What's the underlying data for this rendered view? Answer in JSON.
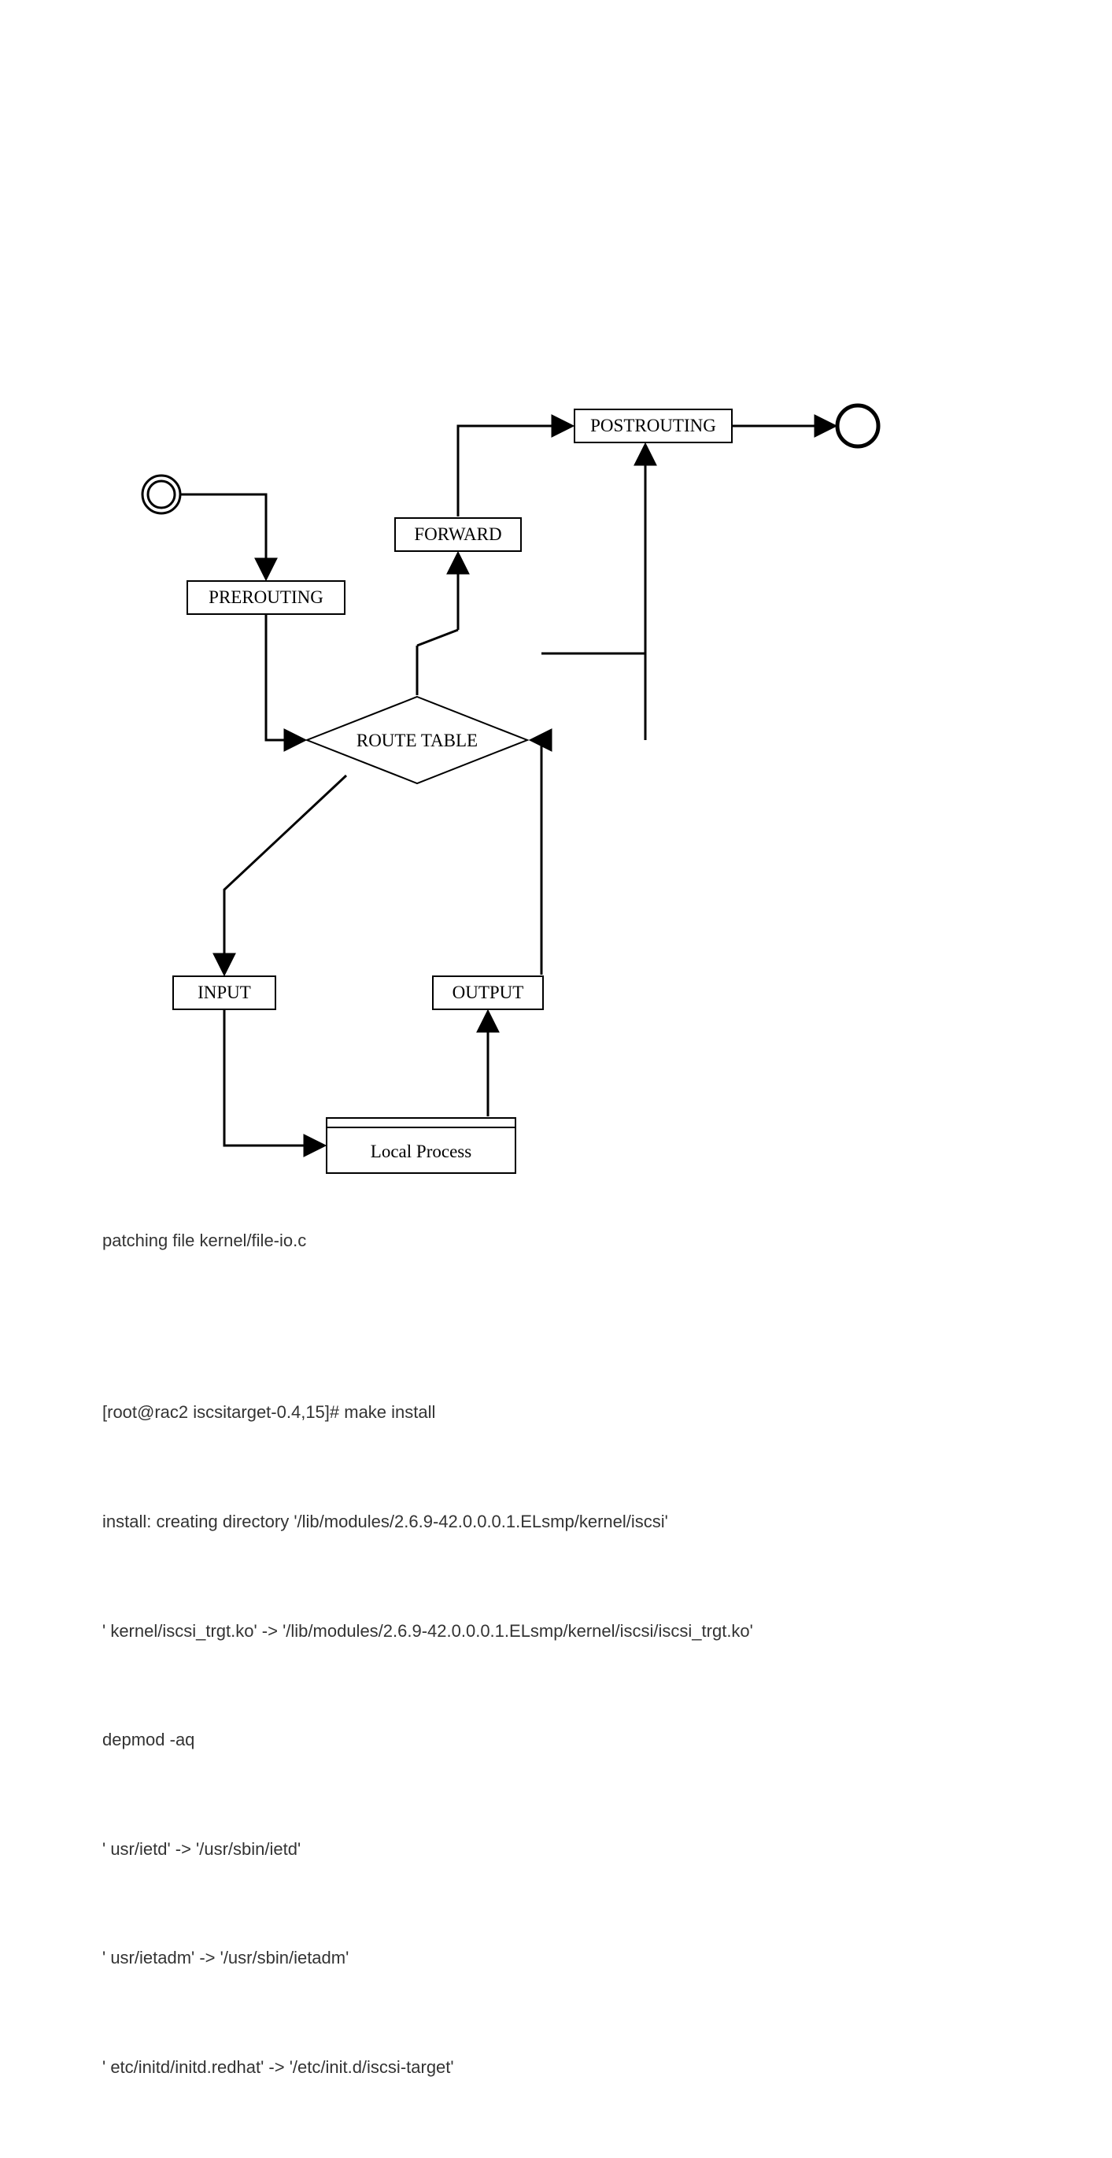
{
  "diagram": {
    "nodes": {
      "prerouting": "PREROUTING",
      "forward": "FORWARD",
      "postrouting": "POSTROUTING",
      "routetable": "ROUTE TABLE",
      "input": "INPUT",
      "output": "OUTPUT",
      "localprocess": "Local Process"
    },
    "edges": [
      {
        "from": "start-circle",
        "to": "prerouting"
      },
      {
        "from": "prerouting",
        "to": "routetable"
      },
      {
        "from": "routetable",
        "to": "forward"
      },
      {
        "from": "forward",
        "to": "postrouting"
      },
      {
        "from": "postrouting",
        "to": "end-circle"
      },
      {
        "from": "routetable",
        "to": "input"
      },
      {
        "from": "input",
        "to": "localprocess"
      },
      {
        "from": "localprocess",
        "to": "output"
      },
      {
        "from": "output",
        "to": "routetable"
      },
      {
        "from": "output",
        "to": "postrouting"
      }
    ]
  },
  "caption": "patching file kernel/file-io.c",
  "terminal": {
    "lines": [
      "[root@rac2 iscsitarget-0.4,15]# make install",
      "install: creating directory '/lib/modules/2.6.9-42.0.0.0.1.ELsmp/kernel/iscsi'",
      "' kernel/iscsi_trgt.ko' -> '/lib/modules/2.6.9-42.0.0.0.1.ELsmp/kernel/iscsi/iscsi_trgt.ko'",
      "depmod -aq",
      "' usr/ietd' -> '/usr/sbin/ietd'",
      "' usr/ietadm' -> '/usr/sbin/ietadm'",
      "' etc/initd/initd.redhat' -> '/etc/init.d/iscsi-target'"
    ]
  }
}
